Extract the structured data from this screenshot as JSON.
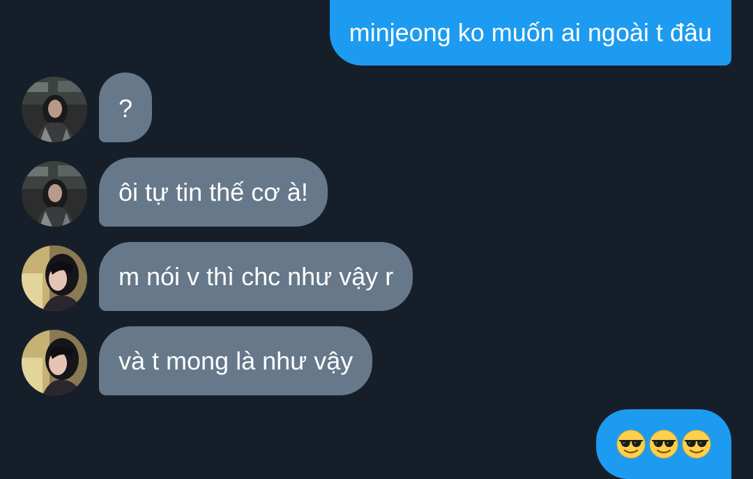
{
  "conversation": {
    "messages": [
      {
        "direction": "outgoing",
        "text": "minjeong ko muốn ai ngoài t đâu"
      },
      {
        "direction": "incoming",
        "text": "?"
      },
      {
        "direction": "incoming",
        "text": "ôi tự tin thế cơ à!"
      },
      {
        "direction": "incoming",
        "text": "m nói v thì chc như vậy r"
      },
      {
        "direction": "incoming",
        "text": "và t mong là như vậy"
      },
      {
        "direction": "outgoing",
        "emoji": [
          "smiling-face-with-sunglasses",
          "smiling-face-with-sunglasses",
          "smiling-face-with-sunglasses"
        ]
      }
    ]
  },
  "colors": {
    "background": "#161f29",
    "outgoing_bubble": "#1d9bf0",
    "incoming_bubble": "#66788a",
    "text": "#ffffff"
  }
}
